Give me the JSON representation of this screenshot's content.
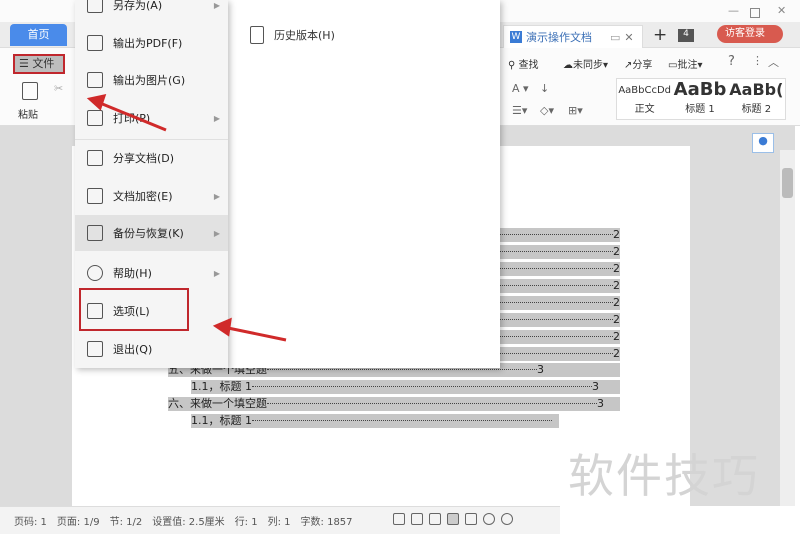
{
  "tabs": {
    "home": "首页",
    "doc": "演示操作文档",
    "count": "4",
    "login": "访客登录"
  },
  "toolbar": {
    "file": "文件",
    "paste": "粘贴",
    "find": "查找",
    "sync": "未同步",
    "share": "分享",
    "comment": "批注",
    "help": "?",
    "styles": [
      {
        "preview": "AaBbCcDd",
        "name": "正文"
      },
      {
        "preview": "AaBb",
        "name": "标题 1"
      },
      {
        "preview": "AaBb(",
        "name": "标题 2"
      }
    ]
  },
  "menu": {
    "items": [
      {
        "label": "另存为(A)",
        "icon": "save-as-icon",
        "arrow": true
      },
      {
        "label": "输出为PDF(F)",
        "icon": "pdf-icon",
        "arrow": false
      },
      {
        "label": "输出为图片(G)",
        "icon": "image-icon",
        "arrow": false
      },
      {
        "label": "打印(P)",
        "icon": "printer-icon",
        "arrow": true
      },
      {
        "label": "分享文档(D)",
        "icon": "share-icon",
        "arrow": false
      },
      {
        "label": "文档加密(E)",
        "icon": "lock-doc-icon",
        "arrow": true
      },
      {
        "label": "备份与恢复(K)",
        "icon": "backup-icon",
        "arrow": true
      },
      {
        "label": "帮助(H)",
        "icon": "help-icon",
        "arrow": true
      },
      {
        "label": "选项(L)",
        "icon": "gear-icon",
        "arrow": false
      },
      {
        "label": "退出(Q)",
        "icon": "exit-icon",
        "arrow": false
      }
    ],
    "submenu": {
      "history": "历史版本(H)"
    }
  },
  "toc": {
    "page2": "2",
    "rows": [
      {
        "text": "五、来做一个填空题",
        "page": "3"
      },
      {
        "text": "1.1，标题 1",
        "page": "3"
      },
      {
        "text": "六、来做一个填空题",
        "page": "3"
      },
      {
        "text": "1.1，标题 1",
        "page": ""
      }
    ]
  },
  "status": {
    "page": "页码: 1",
    "pages": "页面: 1/9",
    "section": "节: 1/2",
    "setting": "设置值: 2.5厘米",
    "row": "行: 1",
    "col": "列: 1",
    "words": "字数: 1857"
  },
  "watermark": "软件技巧",
  "colors": {
    "accent": "#4a8bea",
    "highlight": "#c0272d"
  }
}
